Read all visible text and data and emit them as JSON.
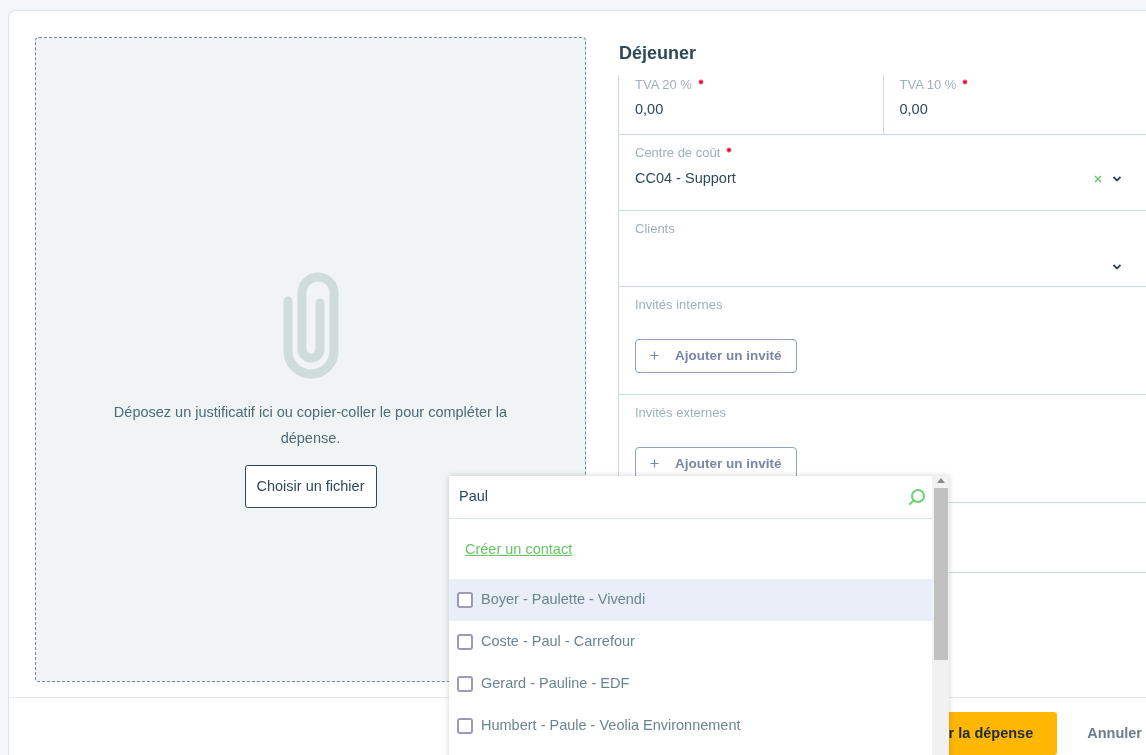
{
  "dropzone": {
    "message": "Déposez un justificatif ici ou copier-coller le pour compléter la dépense.",
    "button": "Choisir un fichier"
  },
  "form": {
    "title": "Déjeuner",
    "tax_fields": [
      {
        "label": "TVA 20 %",
        "required": true,
        "value": "0,00"
      },
      {
        "label": "TVA 10 %",
        "required": true,
        "value": "0,00"
      }
    ],
    "selects": [
      {
        "label": "Centre de coût",
        "required": true,
        "value": "CC04 - Support",
        "clearable": true
      },
      {
        "label": "Clients",
        "required": false,
        "clearable": false
      }
    ],
    "guest_sections": [
      {
        "label": "Invités internes",
        "button": "Ajouter un invité"
      },
      {
        "label": "Invités externes",
        "button": "Ajouter un invité"
      }
    ]
  },
  "footer": {
    "buttons": [
      {
        "label": "r la dépense",
        "kind": "primary"
      },
      {
        "label": "Annuler",
        "kind": "link"
      }
    ]
  },
  "dropdown": {
    "search_value": "Paul",
    "create_link": "Créer un contact",
    "options": [
      {
        "label": "Boyer - Paulette - Vivendi",
        "checked": false,
        "highlighted": true
      },
      {
        "label": "Coste - Paul - Carrefour",
        "checked": false,
        "highlighted": false
      },
      {
        "label": "Gerard - Pauline - EDF",
        "checked": false,
        "highlighted": false
      },
      {
        "label": "Humbert - Paule - Veolia Environnement",
        "checked": false,
        "highlighted": false
      }
    ]
  }
}
